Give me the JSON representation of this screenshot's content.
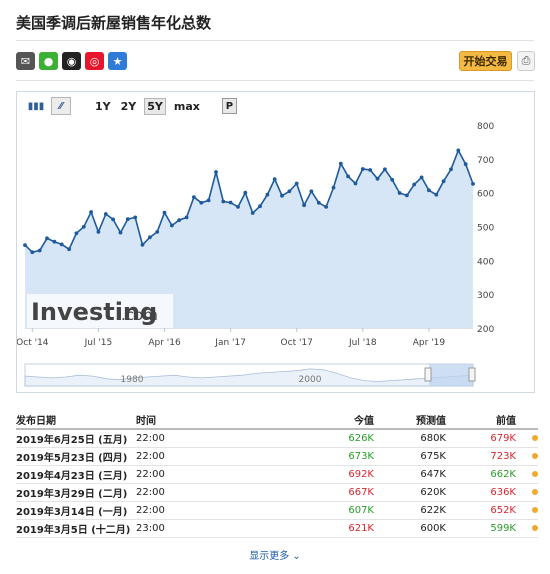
{
  "page_title": "美国季调后新屋销售年化总数",
  "share_icons": [
    {
      "name": "mail-icon",
      "color": "#555555",
      "glyph": "✉"
    },
    {
      "name": "wechat-icon",
      "color": "#3cb034",
      "glyph": "●"
    },
    {
      "name": "qq-icon",
      "color": "#222222",
      "glyph": "◉"
    },
    {
      "name": "weibo-icon",
      "color": "#e6162d",
      "glyph": "◎"
    },
    {
      "name": "star-icon",
      "color": "#2f7bd8",
      "glyph": "★"
    }
  ],
  "buttons": {
    "trade": "开始交易",
    "print_icon": "printer-icon"
  },
  "toolbar": {
    "ranges": [
      "1Y",
      "2Y",
      "5Y",
      "max"
    ],
    "active_range": "5Y",
    "p_label": "P"
  },
  "chart_data": {
    "type": "area",
    "watermark": "Investing",
    "watermark_suffix": ".com",
    "ylim": [
      200,
      800
    ],
    "yticks": [
      200,
      300,
      400,
      500,
      600,
      700,
      800
    ],
    "x_ticks": [
      {
        "label": "Oct '14",
        "index": 1
      },
      {
        "label": "Jul '15",
        "index": 10
      },
      {
        "label": "Apr '16",
        "index": 19
      },
      {
        "label": "Jan '17",
        "index": 28
      },
      {
        "label": "Oct '17",
        "index": 37
      },
      {
        "label": "Jul '18",
        "index": 46
      },
      {
        "label": "Apr '19",
        "index": 55
      }
    ],
    "y_unit": "K",
    "values": [
      445,
      424,
      429,
      465,
      455,
      447,
      433,
      480,
      499,
      543,
      484,
      537,
      521,
      482,
      522,
      527,
      446,
      468,
      484,
      541,
      503,
      519,
      527,
      587,
      570,
      577,
      661,
      574,
      571,
      558,
      600,
      540,
      560,
      594,
      640,
      591,
      604,
      627,
      563,
      604,
      570,
      558,
      615,
      686,
      648,
      627,
      670,
      667,
      641,
      669,
      638,
      599,
      592,
      624,
      645,
      607,
      594,
      634,
      669,
      725,
      684,
      626
    ],
    "navigator": {
      "labels": [
        "1980",
        "2000"
      ]
    }
  },
  "table": {
    "headers": {
      "date": "发布日期",
      "time": "时间",
      "actual": "今值",
      "forecast": "预测值",
      "previous": "前值"
    },
    "rows": [
      {
        "date": "2019年6月25日 (五月)",
        "time": "22:00",
        "actual": "626K",
        "actual_color": "green",
        "forecast": "680K",
        "previous": "679K",
        "previous_color": "red"
      },
      {
        "date": "2019年5月23日 (四月)",
        "time": "22:00",
        "actual": "673K",
        "actual_color": "green",
        "forecast": "675K",
        "previous": "723K",
        "previous_color": "red"
      },
      {
        "date": "2019年4月23日 (三月)",
        "time": "22:00",
        "actual": "692K",
        "actual_color": "red",
        "forecast": "647K",
        "previous": "662K",
        "previous_color": "green"
      },
      {
        "date": "2019年3月29日 (二月)",
        "time": "22:00",
        "actual": "667K",
        "actual_color": "red",
        "forecast": "620K",
        "previous": "636K",
        "previous_color": "red"
      },
      {
        "date": "2019年3月14日 (一月)",
        "time": "22:00",
        "actual": "607K",
        "actual_color": "green",
        "forecast": "622K",
        "previous": "652K",
        "previous_color": "red"
      },
      {
        "date": "2019年3月5日 (十二月)",
        "time": "23:00",
        "actual": "621K",
        "actual_color": "red",
        "forecast": "600K",
        "previous": "599K",
        "previous_color": "green"
      }
    ]
  },
  "show_more": "显示更多"
}
